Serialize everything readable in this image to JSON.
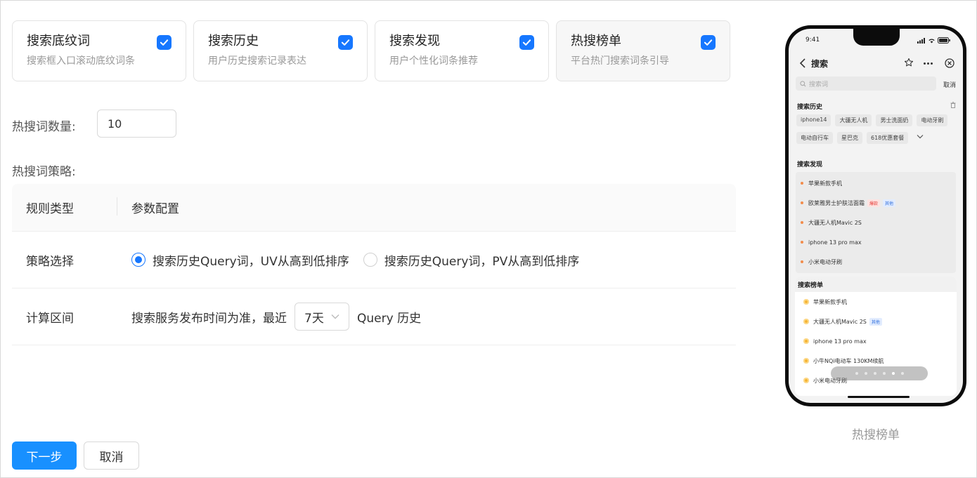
{
  "features": [
    {
      "title": "搜索底纹词",
      "desc": "搜索框入口滚动底纹词条",
      "checked": true
    },
    {
      "title": "搜索历史",
      "desc": "用户历史搜索记录表达",
      "checked": true
    },
    {
      "title": "搜索发现",
      "desc": "用户个性化词条推荐",
      "checked": true
    },
    {
      "title": "热搜榜单",
      "desc": "平台热门搜索词条引导",
      "checked": true
    }
  ],
  "count": {
    "label": "热搜词数量:",
    "value": "10"
  },
  "strategy": {
    "label": "热搜词策略:",
    "headers": [
      "规则类型",
      "参数配置"
    ],
    "rows": {
      "select": {
        "name": "策略选择",
        "options": [
          "搜索历史Query词，UV从高到低排序",
          "搜索历史Query词，PV从高到低排序"
        ],
        "selected_index": 0
      },
      "range": {
        "name": "计算区间",
        "prefix": "搜索服务发布时间为准，最近",
        "select_value": "7天",
        "suffix": "Query 历史"
      }
    }
  },
  "buttons": {
    "next": "下一步",
    "cancel": "取消"
  },
  "phone": {
    "time": "9:41",
    "nav_title": "搜索",
    "search_placeholder": "搜索词",
    "search_cancel": "取消",
    "history_title": "搜索历史",
    "history_row1": [
      "iphone14",
      "大疆无人机",
      "男士洗面奶",
      "电动牙刷"
    ],
    "history_row2": [
      "电动自行车",
      "星巴克",
      "618优惠套餐"
    ],
    "discover_title": "搜索发现",
    "discover_items": [
      {
        "text": "苹果新款手机"
      },
      {
        "text": "欧莱雅男士护肤洁面霜",
        "tags": [
          {
            "text": "爆款",
            "color": "red"
          },
          {
            "text": "其他",
            "color": "blue"
          }
        ]
      },
      {
        "text": "大疆无人机Mavic 2S"
      },
      {
        "text": "iphone 13 pro max"
      },
      {
        "text": "小米电动牙刷"
      }
    ],
    "rank_title": "搜索榜单",
    "rank_items": [
      {
        "text": "苹果新款手机"
      },
      {
        "text": "大疆无人机Mavic 2S",
        "tags": [
          {
            "text": "其他",
            "color": "blue"
          }
        ]
      },
      {
        "text": "iphone 13 pro max"
      },
      {
        "text": "小牛NQi电动车 130KM续航"
      },
      {
        "text": "小米电动牙刷"
      }
    ],
    "pager_count": 6,
    "pager_active": 4,
    "caption": "热搜榜单"
  },
  "colors": {
    "primary": "#1890ff",
    "checkbox": "#1677ff"
  }
}
